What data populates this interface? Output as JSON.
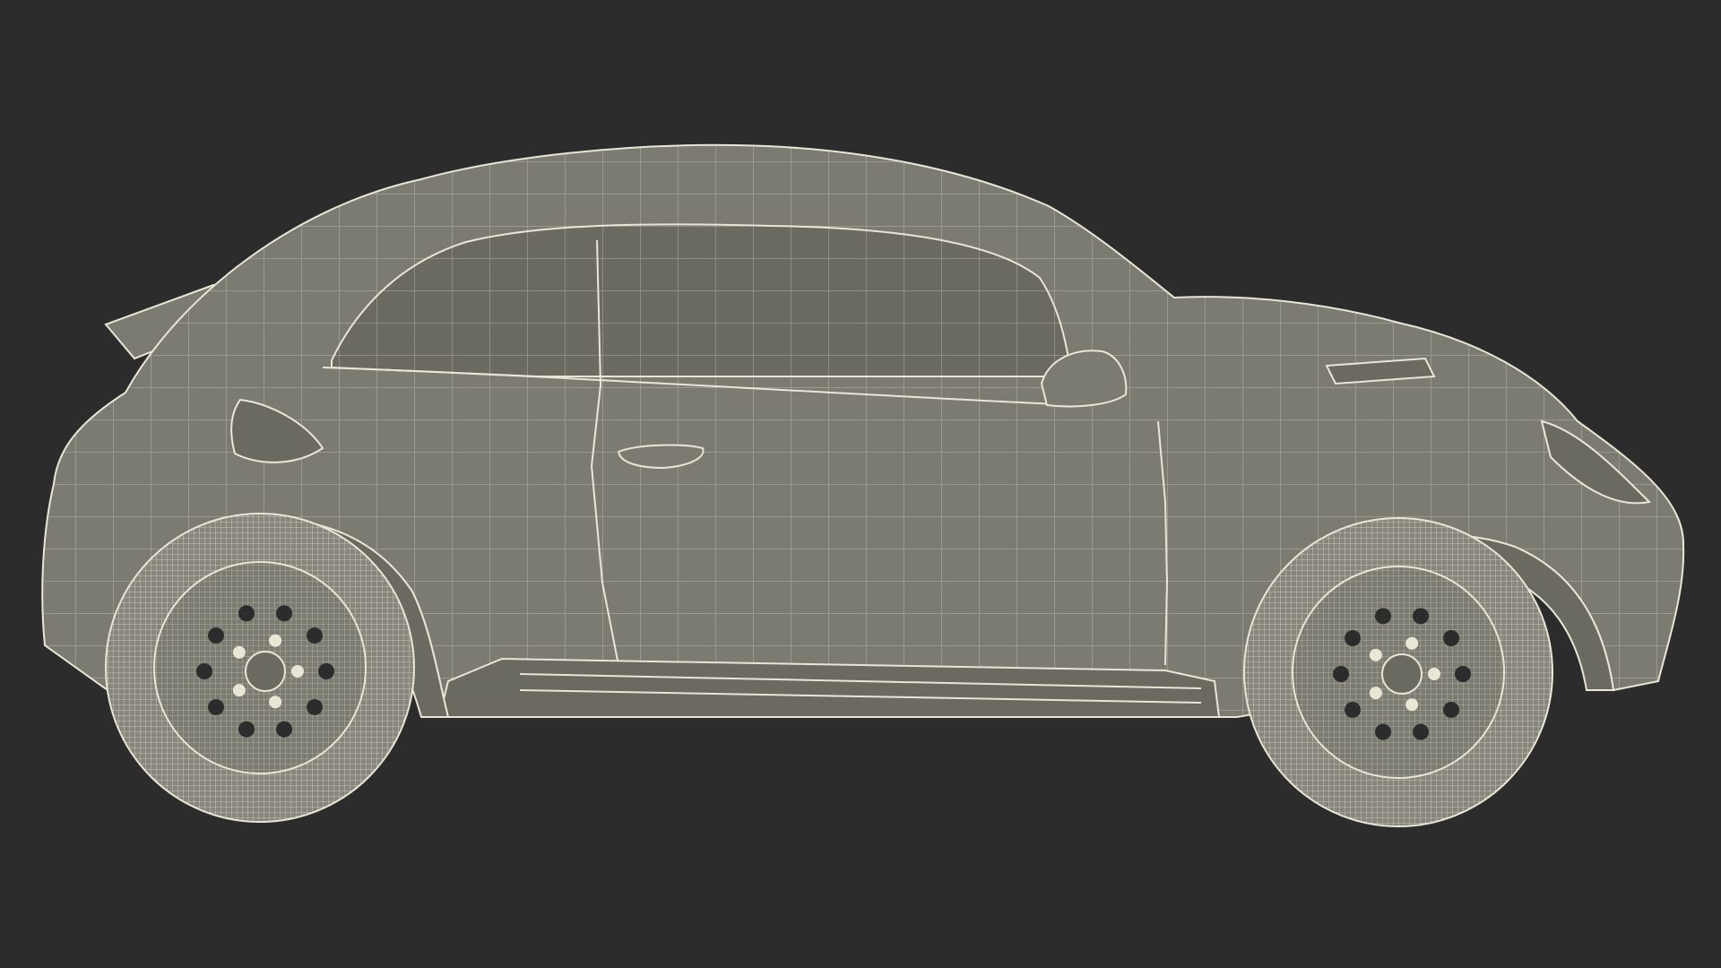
{
  "scene": {
    "subject": "wireframe-car-side-view",
    "background_color": "#2c2c2c",
    "body_color": "#7b7b71",
    "body_shade_color": "#6a6a61",
    "wire_color": "#e9e6d6",
    "tire_color": "#86867c"
  }
}
